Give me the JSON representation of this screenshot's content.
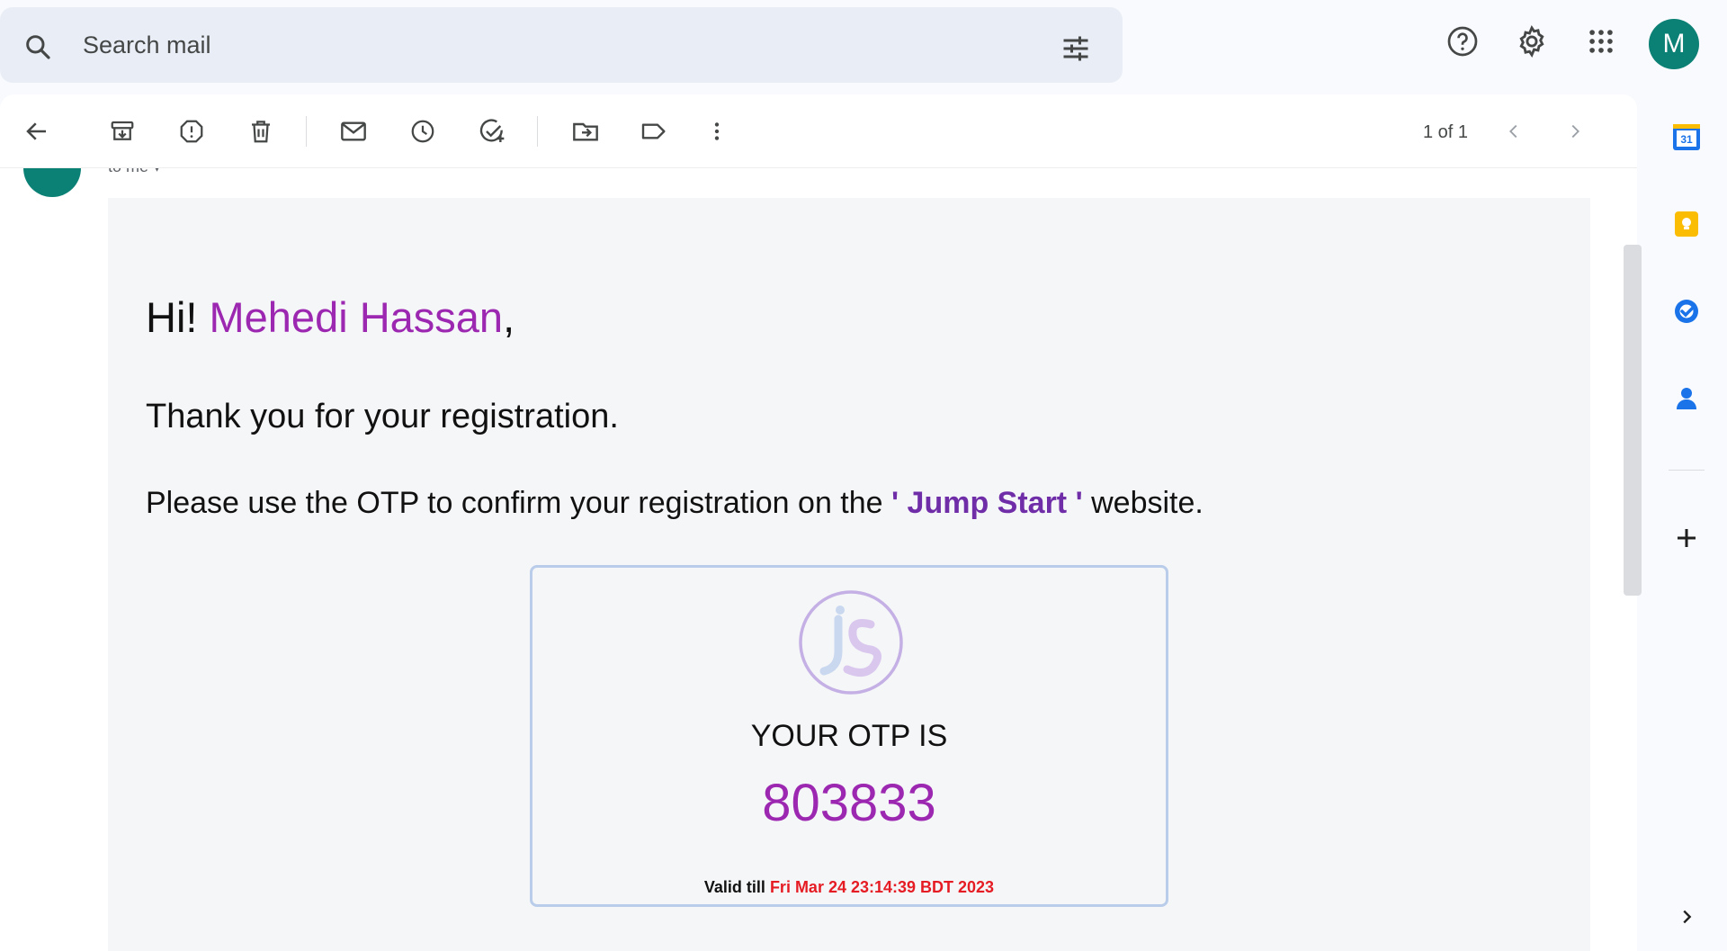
{
  "search": {
    "placeholder": "Search mail"
  },
  "header": {
    "avatar_letter": "M"
  },
  "toolbar": {
    "pager_text": "1 of 1"
  },
  "message": {
    "recipient_text": "to me"
  },
  "email": {
    "greeting_prefix": "Hi! ",
    "recipient_name": "Mehedi Hassan",
    "greeting_suffix": ",",
    "thanks": "Thank you for your registration.",
    "instruction_prefix": "Please use the OTP to confirm your registration on the ",
    "site_name": "' Jump Start '",
    "instruction_suffix": " website.",
    "otp_label": "YOUR OTP IS",
    "otp_code": "803833",
    "valid_prefix": "Valid till ",
    "valid_date": "Fri Mar 24 23:14:39 BDT 2023"
  },
  "side_panel": {
    "calendar_day": "31"
  },
  "colors": {
    "accent_purple": "#9c27b0",
    "site_purple": "#6f2da8",
    "date_red": "#e51c23",
    "avatar_green": "#0b8074"
  },
  "icons": [
    "search-icon",
    "tune-icon",
    "help-icon",
    "gear-icon",
    "apps-icon",
    "back-arrow-icon",
    "archive-icon",
    "report-spam-icon",
    "delete-icon",
    "mark-unread-icon",
    "snooze-icon",
    "add-task-icon",
    "move-to-icon",
    "label-icon",
    "more-vert-icon",
    "chevron-left-icon",
    "chevron-right-icon",
    "calendar-icon",
    "keep-icon",
    "tasks-icon",
    "contacts-icon",
    "plus-icon"
  ]
}
